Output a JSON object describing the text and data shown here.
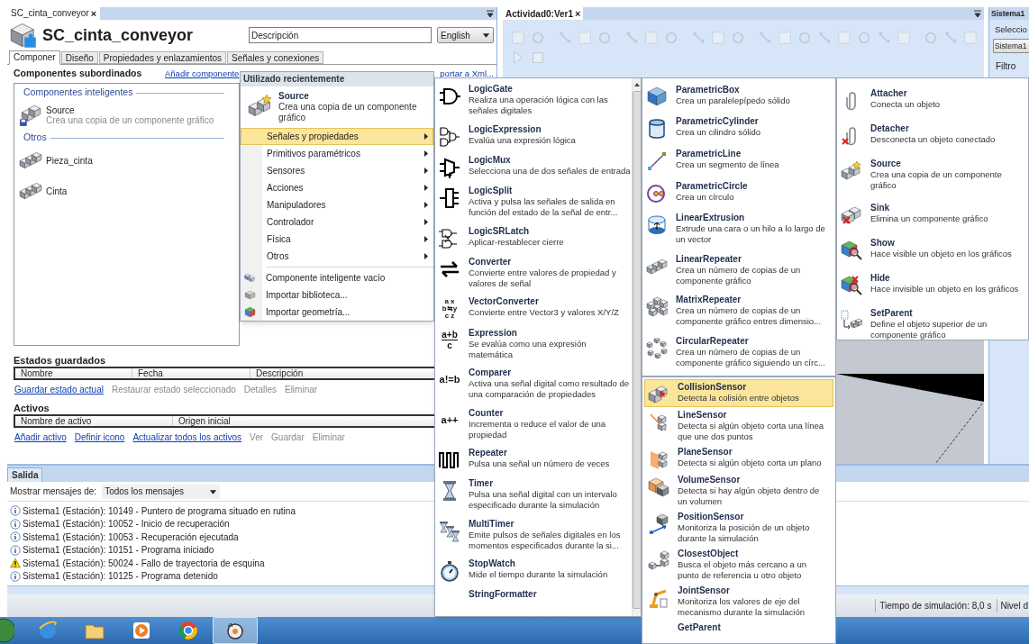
{
  "component_editor": {
    "tab": "SC_cinta_conveyor",
    "close": "×",
    "title": "SC_cinta_conveyor",
    "description": {
      "value": "Descripción"
    },
    "language": "English",
    "tabs": [
      {
        "label": "Componer",
        "selected": true
      },
      {
        "label": "Diseño",
        "selected": false
      },
      {
        "label": "Propiedades y enlazamientos",
        "selected": false
      },
      {
        "label": "Señales y conexiones",
        "selected": false
      }
    ],
    "children_heading": "Componentes subordinados",
    "add_link": "Añadir componente",
    "export_link": "portar a Xml...",
    "component_groups": [
      {
        "title": "Componentes inteligentes",
        "items": [
          {
            "name": "Source",
            "description": "Crea una copia de un componente gráfico"
          }
        ]
      },
      {
        "title": "Otros",
        "items": [
          {
            "name": "Pieza_cinta"
          },
          {
            "name": "Cinta"
          }
        ]
      }
    ],
    "saved_states": {
      "title": "Estados guardados",
      "columns": [
        "Nombre",
        "Fecha",
        "Descripción"
      ],
      "actions": [
        {
          "label": "Guardar estado actual",
          "disabled": false
        },
        {
          "label": "Restaurar estado seleccionado",
          "disabled": true
        },
        {
          "label": "Detalles",
          "disabled": true
        },
        {
          "label": "Eliminar",
          "disabled": true
        }
      ]
    },
    "assets": {
      "title": "Activos",
      "columns": [
        "Nombre de activo",
        "Origen inicial"
      ],
      "actions": [
        {
          "label": "Añadir activo",
          "disabled": false
        },
        {
          "label": "Definir icono",
          "disabled": false
        },
        {
          "label": "Actualizar todos los activos",
          "disabled": false
        },
        {
          "label": "Ver",
          "disabled": true
        },
        {
          "label": "Guardar",
          "disabled": true
        },
        {
          "label": "Eliminar",
          "disabled": true
        }
      ]
    }
  },
  "view": {
    "tab": "Actividad0:Ver1",
    "close": "×"
  },
  "side_panel": {
    "tab": "Sistema1",
    "selection_label": "Seleccio",
    "selection_value": "Sistema1",
    "filter_label": "Filtro"
  },
  "output": {
    "tab": "Salida",
    "filter_label": "Mostrar mensajes de:",
    "filter_value": "Todos los mensajes",
    "messages": [
      {
        "kind": "info",
        "text": "Sistema1 (Estación): 10149 - Puntero de programa situado en rutina"
      },
      {
        "kind": "info",
        "text": "Sistema1 (Estación): 10052 - Inicio de recuperación"
      },
      {
        "kind": "info",
        "text": "Sistema1 (Estación): 10053 - Recuperación ejecutada"
      },
      {
        "kind": "info",
        "text": "Sistema1 (Estación): 10151 - Programa iniciado"
      },
      {
        "kind": "warning",
        "text": "Sistema1 (Estación): 50024 - Fallo de trayectoria de esquina"
      },
      {
        "kind": "info",
        "text": "Sistema1 (Estación): 10125 - Programa detenido"
      }
    ]
  },
  "status_bar": {
    "simulation_time": "Tiempo de simulación: 8,0 s",
    "level": "Nivel d"
  },
  "add_component_menu": {
    "header": "Utilizado recientemente",
    "recent": [
      {
        "name": "Source",
        "description": "Crea una copia de un componente gráfico"
      }
    ],
    "categories": [
      {
        "label": "Señales y propiedades",
        "selected": true
      },
      {
        "label": "Primitivos paramétricos",
        "selected": false
      },
      {
        "label": "Sensores",
        "selected": false
      },
      {
        "label": "Acciones",
        "selected": false
      },
      {
        "label": "Manipuladores",
        "selected": false
      },
      {
        "label": "Controlador",
        "selected": false
      },
      {
        "label": "Física",
        "selected": false
      },
      {
        "label": "Otros",
        "selected": false
      }
    ],
    "commands": [
      "Componente inteligente vacío",
      "Importar biblioteca...",
      "Importar geometría..."
    ]
  },
  "signals_menu": [
    {
      "name": "LogicGate",
      "description": "Realiza una operación lógica con las señales digitales"
    },
    {
      "name": "LogicExpression",
      "description": "Evalúa una expresión lógica"
    },
    {
      "name": "LogicMux",
      "description": "Selecciona una de dos señales de entrada"
    },
    {
      "name": "LogicSplit",
      "description": "Activa y pulsa las señales de salida en función del estado de la señal de entr..."
    },
    {
      "name": "LogicSRLatch",
      "description": "Aplicar-restablecer cierre"
    },
    {
      "name": "Converter",
      "description": "Convierte entre valores de propiedad y valores de señal"
    },
    {
      "name": "VectorConverter",
      "description": "Convierte entre Vector3 y valores X/Y/Z",
      "icon_text": [
        "a x",
        "b≒y",
        "c z"
      ]
    },
    {
      "name": "Expression",
      "description": "Se evalúa como una expresión matemática",
      "icon_text": [
        "a+b",
        "c"
      ]
    },
    {
      "name": "Comparer",
      "description": "Activa una señal digital como resultado de una comparación de propiedades",
      "icon_text": [
        "a!=b"
      ]
    },
    {
      "name": "Counter",
      "description": "Incrementa o reduce el valor de una propiedad",
      "icon_text": [
        "a++"
      ]
    },
    {
      "name": "Repeater",
      "description": "Pulsa una señal un número de veces"
    },
    {
      "name": "Timer",
      "description": "Pulsa una señal digital con un intervalo especificado durante la simulación"
    },
    {
      "name": "MultiTimer",
      "description": "Emite pulsos de señales digitales en los momentos especificados durante la si..."
    },
    {
      "name": "StopWatch",
      "description": "Mide el tiempo durante la simulación"
    },
    {
      "name": "StringFormatter"
    }
  ],
  "primitives_menu": [
    {
      "name": "ParametricBox",
      "description": "Crea un paralelepípedo sólido"
    },
    {
      "name": "ParametricCylinder",
      "description": "Crea un cilindro sólido"
    },
    {
      "name": "ParametricLine",
      "description": "Crea un segmento de línea"
    },
    {
      "name": "ParametricCircle",
      "description": "Crea un círculo"
    },
    {
      "name": "LinearExtrusion",
      "description": "Extrude una cara o un hilo a lo largo de un vector"
    },
    {
      "name": "LinearRepeater",
      "description": "Crea un número de copias de un componente gráfico"
    },
    {
      "name": "MatrixRepeater",
      "description": "Crea un número de copias de un componente gráfico entres dimensio..."
    },
    {
      "name": "CircularRepeater",
      "description": "Crea un número de copias de un componente gráfico siguiendo un círc..."
    }
  ],
  "sensors_menu": [
    {
      "name": "CollisionSensor",
      "description": "Detecta la colisión entre objetos",
      "selected": true
    },
    {
      "name": "LineSensor",
      "description": "Detecta si algún objeto corta una línea que une dos puntos",
      "selected": false
    },
    {
      "name": "PlaneSensor",
      "description": "Detecta si algún objeto corta un plano",
      "selected": false
    },
    {
      "name": "VolumeSensor",
      "description": "Detecta si hay algún objeto dentro de un volumen",
      "selected": false
    },
    {
      "name": "PositionSensor",
      "description": "Monitoriza la posición de un objeto durante la simulación",
      "selected": false
    },
    {
      "name": "ClosestObject",
      "description": "Busca el objeto más cercano a un punto de referencia u otro objeto",
      "selected": false
    },
    {
      "name": "JointSensor",
      "description": "Monitoriza los valores de eje del mecanismo durante la simulación",
      "selected": false
    },
    {
      "name": "GetParent",
      "selected": false
    }
  ],
  "actions_menu": [
    {
      "name": "Attacher",
      "description": "Conecta un objeto"
    },
    {
      "name": "Detacher",
      "description": "Desconecta un objeto conectado"
    },
    {
      "name": "Source",
      "description": "Crea una copia de un componente gráfico"
    },
    {
      "name": "Sink",
      "description": "Elimina un componente gráfico"
    },
    {
      "name": "Show",
      "description": "Hace visible un objeto en los gráficos"
    },
    {
      "name": "Hide",
      "description": "Hace invisible un objeto en los gráficos"
    },
    {
      "name": "SetParent",
      "description": "Define el objeto superior de un componente gráfico"
    }
  ]
}
